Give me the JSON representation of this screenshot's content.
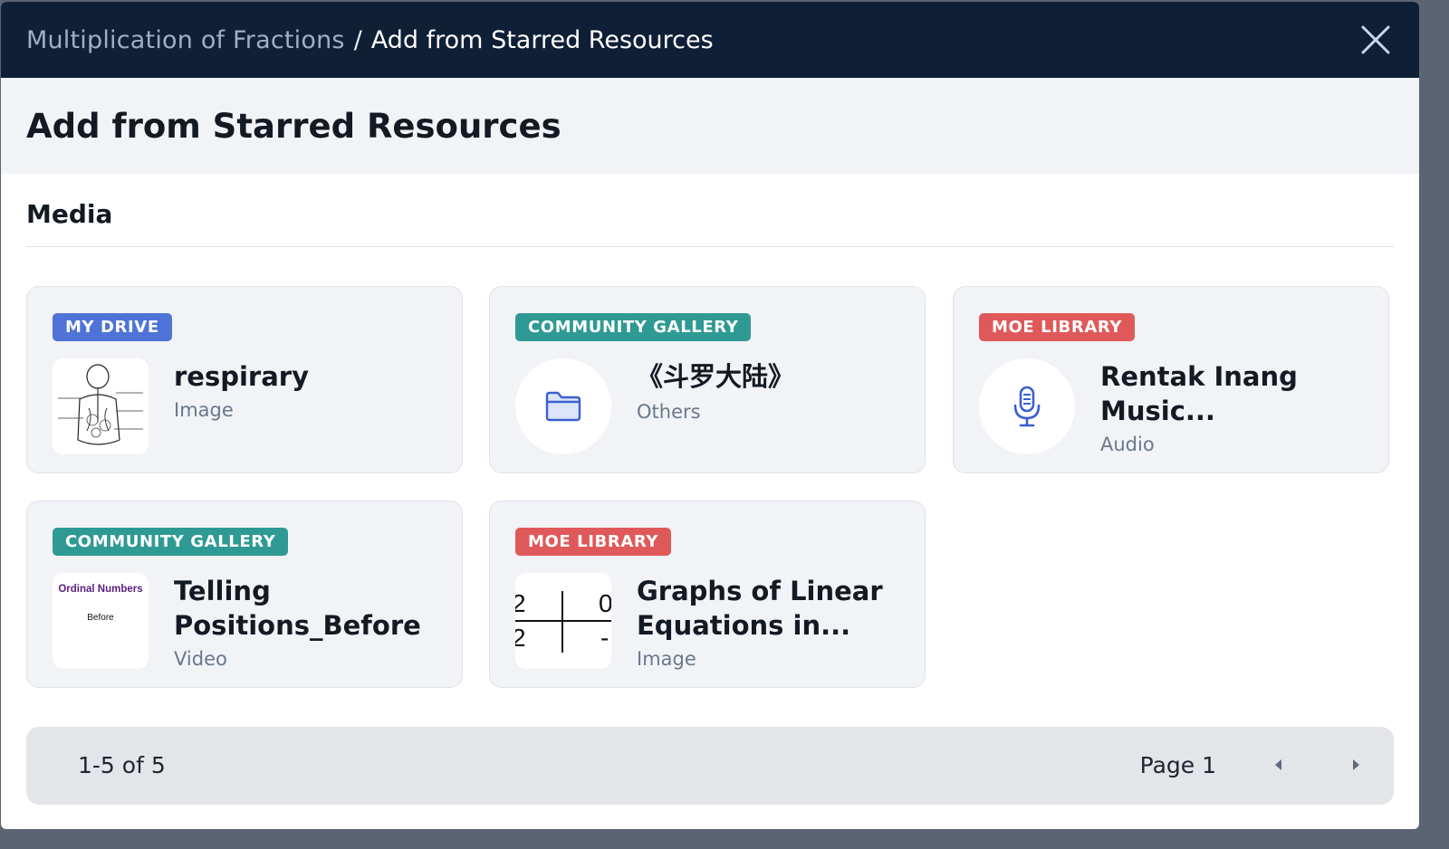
{
  "header": {
    "breadcrumb_parent": "Multiplication of Fractions",
    "breadcrumb_separator": "/",
    "breadcrumb_current": "Add from Starred Resources"
  },
  "page_title": "Add from Starred Resources",
  "section_title": "Media",
  "cards": [
    {
      "badge": "MY DRIVE",
      "badge_color": "#4f73d6",
      "title": "respirary",
      "type": "Image",
      "thumb": "respiratory-diagram"
    },
    {
      "badge": "COMMUNITY GALLERY",
      "badge_color": "#2f9a94",
      "title": "《斗罗大陆》",
      "type": "Others",
      "thumb": "folder-icon"
    },
    {
      "badge": "MOE LIBRARY",
      "badge_color": "#e0595a",
      "title": "Rentak Inang Music...",
      "type": "Audio",
      "thumb": "microphone-icon"
    },
    {
      "badge": "COMMUNITY GALLERY",
      "badge_color": "#2f9a94",
      "title": "Telling Positions_Before",
      "type": "Video",
      "thumb": "video-thumbnail",
      "thumb_text_1": "Ordinal Numbers",
      "thumb_text_2": "Before"
    },
    {
      "badge": "MOE LIBRARY",
      "badge_color": "#e0595a",
      "title": "Graphs of Linear Equations in...",
      "type": "Image",
      "thumb": "table-image",
      "thumb_cells": [
        "2",
        "0",
        "2",
        "-"
      ]
    }
  ],
  "pagination": {
    "range_text": "1-5 of 5",
    "page_text": "Page 1",
    "prev_icon": "caret-left-icon",
    "next_icon": "caret-right-icon"
  }
}
